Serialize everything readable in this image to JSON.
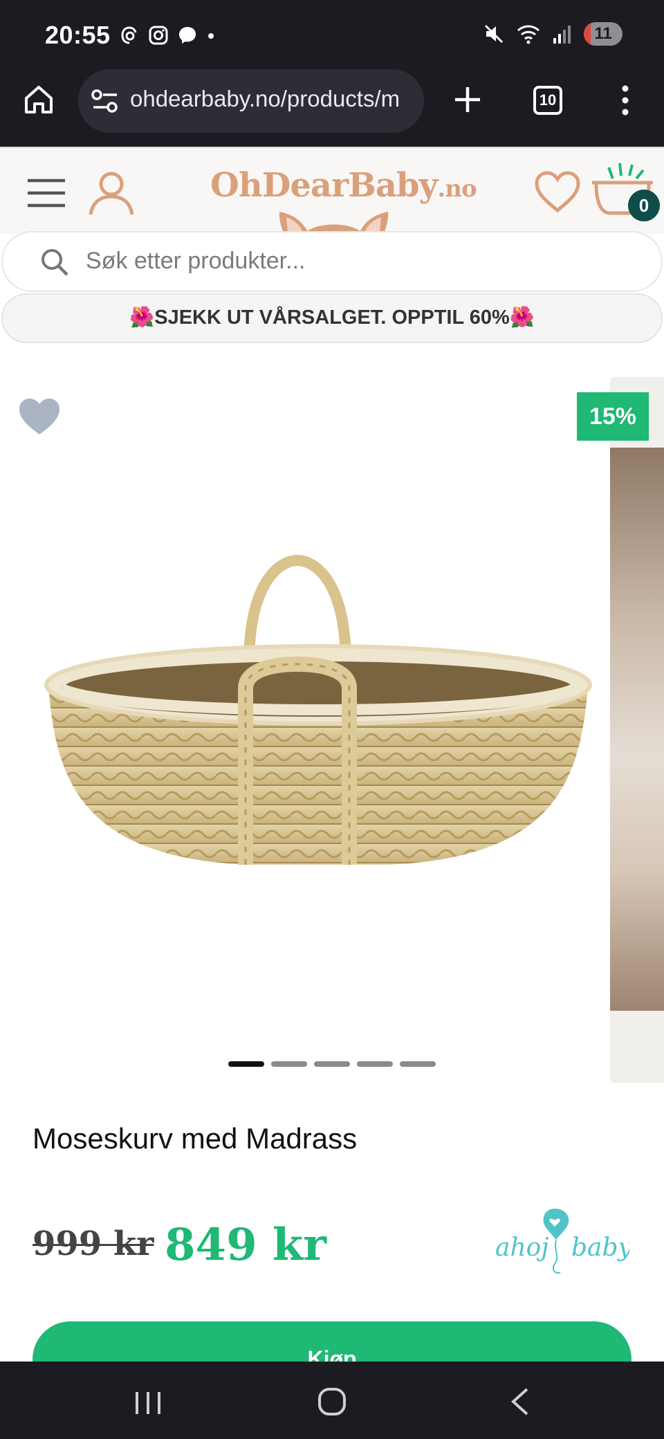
{
  "status_bar": {
    "time": "20:55",
    "notification_icons": [
      "threads-icon",
      "instagram-icon",
      "messenger-icon",
      "dot-icon"
    ],
    "system_icons": [
      "mute-icon",
      "wifi-icon",
      "signal-icon"
    ],
    "battery_level": "11",
    "battery_color": "#e0483e"
  },
  "browser": {
    "url": "ohdearbaby.no/products/m",
    "tab_count": "10"
  },
  "site": {
    "logo_main": "OhDearBaby",
    "logo_tld": ".no",
    "cart_count": "0",
    "search_placeholder": "Søk etter produkter...",
    "promo_text": "🌺SJEKK UT VÅRSALGET. OPPTIL 60%🌺",
    "brand_color": "#d9a07c",
    "accent_color": "#1fb875"
  },
  "product": {
    "discount_badge": "15%",
    "image_count": 5,
    "active_image": 1,
    "title": "Moseskurv med Madrass",
    "old_price": "999 kr",
    "new_price": "849 kr",
    "brand_logo_left": "ahoj",
    "brand_logo_right": "baby",
    "buy_label": "Kjøp"
  }
}
